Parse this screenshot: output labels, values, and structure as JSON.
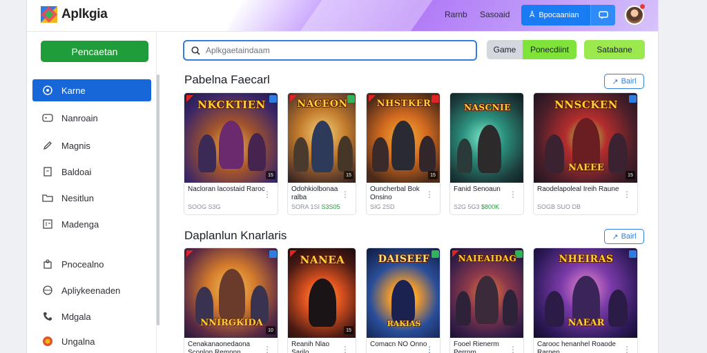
{
  "header": {
    "brand": "Aplkgia",
    "nav": [
      "Rarnb",
      "Sasoaid"
    ],
    "cta_label": "Bpocaanian",
    "colors": {
      "accent": "#1a7cf2",
      "brand_green": "#1f9d3a",
      "wave": "#a86bf5"
    }
  },
  "sidebar": {
    "cta_label": "Pencaetan",
    "items": [
      {
        "label": "Karne",
        "icon": "gamepad-icon",
        "active": true
      },
      {
        "label": "Nanroain",
        "icon": "controller-icon"
      },
      {
        "label": "Magnis",
        "icon": "pen-icon"
      },
      {
        "label": "Baldoai",
        "icon": "document-icon"
      },
      {
        "label": "Nesitlun",
        "icon": "folder-icon"
      },
      {
        "label": "Madenga",
        "icon": "grid-icon"
      },
      {
        "label": "Pnocealno",
        "icon": "puzzle-icon"
      },
      {
        "label": "Apliykeenaden",
        "icon": "globe-icon"
      },
      {
        "label": "Mdgala",
        "icon": "phone-icon"
      },
      {
        "label": "Ungalna",
        "icon": "badge-icon"
      }
    ]
  },
  "search": {
    "placeholder": "Aplkgaetaindaam"
  },
  "filters": [
    "Game",
    "Ponecdiint",
    "Satabane"
  ],
  "sections": [
    {
      "title": "Pabelna Faecarl",
      "see_all": "Bairl",
      "cards": [
        {
          "art_title": "NKCKTIEN",
          "name": "Nacloran lacostaid Raroc",
          "meta": "SOOG S3G",
          "price": ""
        },
        {
          "art_title": "NACEON",
          "name": "Odohkiolbonaa ralba",
          "meta": "SORA 1SI",
          "price": "S3S05"
        },
        {
          "art_title": "NHSTKER",
          "name": "Ouncherbal Bok Onsino",
          "meta": "SIG 2SD",
          "price": ""
        },
        {
          "art_title": "NASCNIE",
          "name": "Fanid Senoaun",
          "meta": "S2G 5G3",
          "price": "$800K"
        },
        {
          "art_title": "NNSCKEN",
          "name": "Raodelapoleal Ireih Raune",
          "meta": "SOGB SUO DB",
          "price": ""
        }
      ]
    },
    {
      "title": "Daplanlun Knarlaris",
      "see_all": "Bairl",
      "cards": [
        {
          "art_title": "NNIRGKIDA",
          "name": "Cenakanaonedaona Sconlon Remnnn",
          "meta": "",
          "price": ""
        },
        {
          "art_title": "NANEA",
          "name": "Reanih Nlao Sarilo",
          "meta": "",
          "price": ""
        },
        {
          "art_title": "DAISEEF",
          "name": "Comacn NO Onno",
          "meta": "",
          "price": ""
        },
        {
          "art_title": "NAIEAIDAG",
          "name": "Fooel Rienerm Perrnm",
          "meta": "",
          "price": ""
        },
        {
          "art_title": "NHEIRAS",
          "name": "Carooc henanhel Roaode Rarnen",
          "meta": "",
          "price": ""
        }
      ]
    }
  ]
}
